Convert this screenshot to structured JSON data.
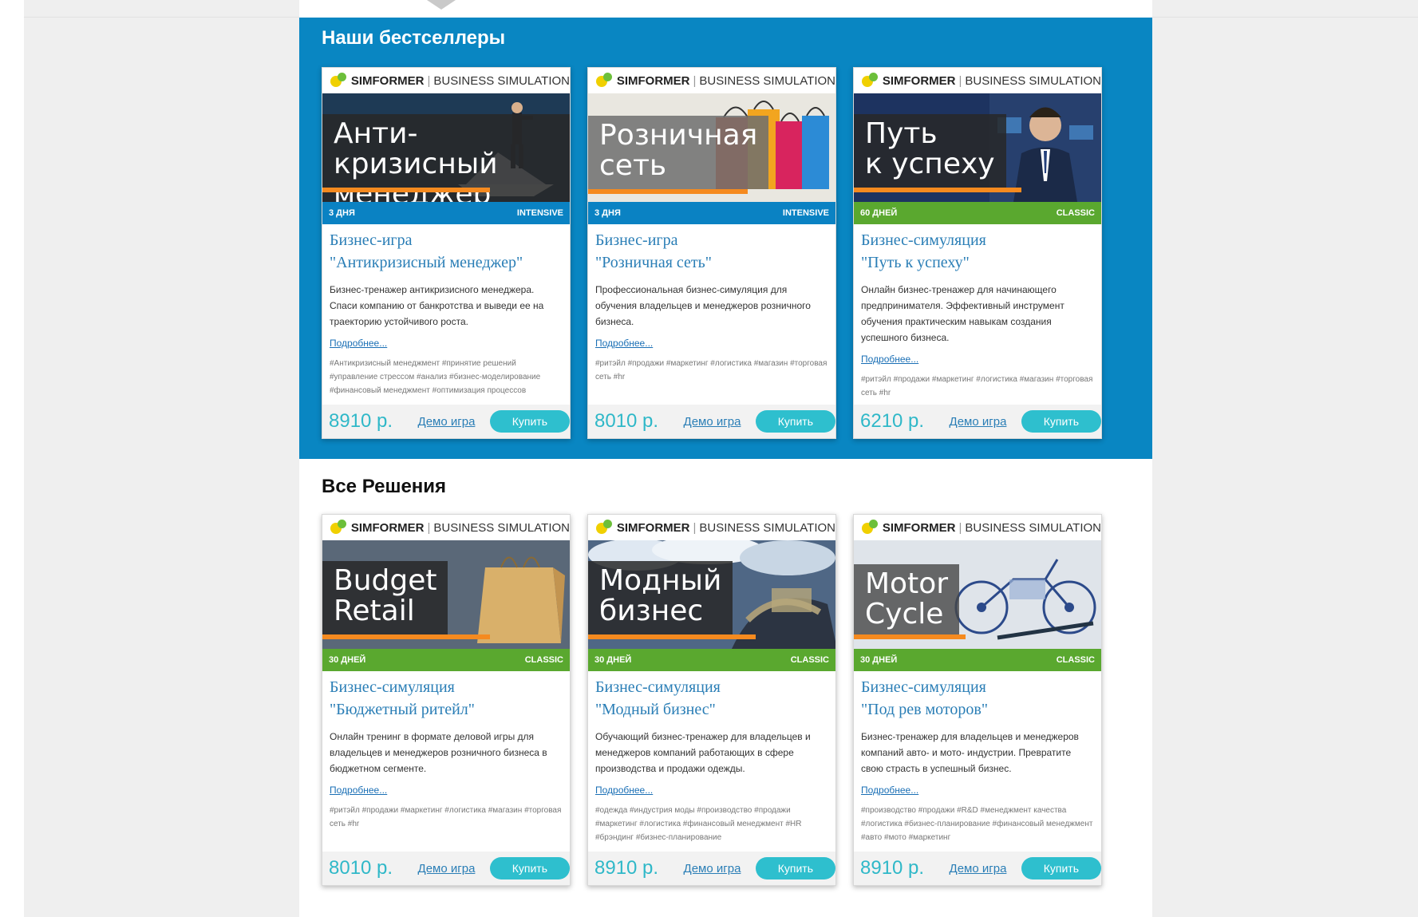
{
  "brand": {
    "bold": "SIMFORMER",
    "sep": "|",
    "rest": "BUSINESS SIMULATION"
  },
  "colors": {
    "blue": "#0986c2",
    "green": "#5aa82f",
    "accent": "#2ebfce",
    "orange": "#f58a1f"
  },
  "bestsellers": {
    "title": "Наши бестселлеры",
    "cards": [
      {
        "image": {
          "line1": "Анти-кризисный",
          "line2": "менеджер",
          "bg": "#1e3a55",
          "figure": "businessman-on-paper-boat"
        },
        "ribbon": {
          "duration": "3 ДНЯ",
          "type": "INTENSIVE",
          "color": "blue"
        },
        "title_line1": "Бизнес-игра",
        "title_line2": "\"Антикризисный менеджер\"",
        "description": "Бизнес-тренажер антикризисного менеджера. Спаси компанию от банкротства и выведи ее на траекторию устойчивого роста.",
        "more": "Подробнее...",
        "tags": "#Антикризисный менеджмент  #принятие решений  #управление стрессом  #анализ  #бизнес-моделирование  #финансовый менеджмент  #оптимизация процессов",
        "price": "8910 р.",
        "demo": "Демо игра",
        "buy": "Купить"
      },
      {
        "image": {
          "line1": "Розничная",
          "line2": "сеть",
          "bg": "#e9e7e0",
          "figure": "shopping-bags"
        },
        "ribbon": {
          "duration": "3 ДНЯ",
          "type": "INTENSIVE",
          "color": "blue"
        },
        "title_line1": "Бизнес-игра",
        "title_line2": "\"Розничная сеть\"",
        "description": "Профессиональная бизнес-симуляция для обучения владельцев и менеджеров розничного бизнеса.",
        "more": "Подробнее...",
        "tags": "#ритэйл  #продажи  #маркетинг  #логистика  #магазин  #торговая сеть  #hr",
        "price": "8010 р.",
        "demo": "Демо игра",
        "buy": "Купить"
      },
      {
        "image": {
          "line1": "Путь",
          "line2": "к успеху",
          "bg": "#1d3360",
          "figure": "businessman-portrait"
        },
        "ribbon": {
          "duration": "60 ДНЕЙ",
          "type": "CLASSIC",
          "color": "green"
        },
        "title_line1": "Бизнес-симуляция",
        "title_line2": "\"Путь к успеху\"",
        "description": "Онлайн бизнес-тренажер для начинающего предпринимателя. Эффективный инструмент обучения практическим навыкам создания успешного бизнеса.",
        "more": "Подробнее...",
        "tags": "#ритэйл  #продажи  #маркетинг  #логистика  #магазин  #торговая сеть  #hr",
        "price": "6210 р.",
        "demo": "Демо игра",
        "buy": "Купить"
      }
    ]
  },
  "all": {
    "title": "Все Решения",
    "cards": [
      {
        "image": {
          "line1": "Budget",
          "line2": "Retail",
          "bg": "#5a6878",
          "figure": "paper-bag"
        },
        "ribbon": {
          "duration": "30 ДНЕЙ",
          "type": "CLASSIC",
          "color": "green"
        },
        "title_line1": "Бизнес-симуляция",
        "title_line2": "\"Бюджетный ритейл\"",
        "description": "Онлайн тренинг в формате деловой игры для владельцев и менеджеров розничного бизнеса в бюджетном сегменте.",
        "more": "Подробнее...",
        "tags": "#ритэйл  #продажи  #маркетинг  #логистика  #магазин  #торговая сеть  #hr",
        "price": "8010 р.",
        "demo": "Демо игра",
        "buy": "Купить"
      },
      {
        "image": {
          "line1": "Модный",
          "line2": "бизнес",
          "bg": "#3a4a5e",
          "figure": "fabric-and-clouds"
        },
        "ribbon": {
          "duration": "30 ДНЕЙ",
          "type": "CLASSIC",
          "color": "green"
        },
        "title_line1": "Бизнес-симуляция",
        "title_line2": "\"Модный бизнес\"",
        "description": "Обучающий бизнес-тренажер для владельцев и менеджеров компаний работающих в сфере производства и продажи одежды.",
        "more": "Подробнее...",
        "tags": "#одежда  #индустрия моды  #производство  #продажи  #маркетинг  #логистика  #финансовый менеджмент  #HR  #брэндинг  #бизнес-планирование",
        "price": "8910 р.",
        "demo": "Демо игра",
        "buy": "Купить"
      },
      {
        "image": {
          "line1": "Motor",
          "line2": "Cycle",
          "bg": "#dfe4ea",
          "figure": "motorcycle-sketch"
        },
        "ribbon": {
          "duration": "30 ДНЕЙ",
          "type": "CLASSIC",
          "color": "green"
        },
        "title_line1": "Бизнес-симуляция",
        "title_line2": "\"Под рев моторов\"",
        "description": "Бизнес-тренажер для владельцев и менеджеров компаний авто- и мото- индустрии. Превратите свою страсть в успешный бизнес.",
        "more": "Подробнее...",
        "tags": "#производство  #продажи  #R&D  #менеджмент качества  #логистика  #бизнес-планирование  #финансовый менеджмент  #авто  #мото  #маркетинг",
        "price": "8910 р.",
        "demo": "Демо игра",
        "buy": "Купить"
      }
    ]
  }
}
